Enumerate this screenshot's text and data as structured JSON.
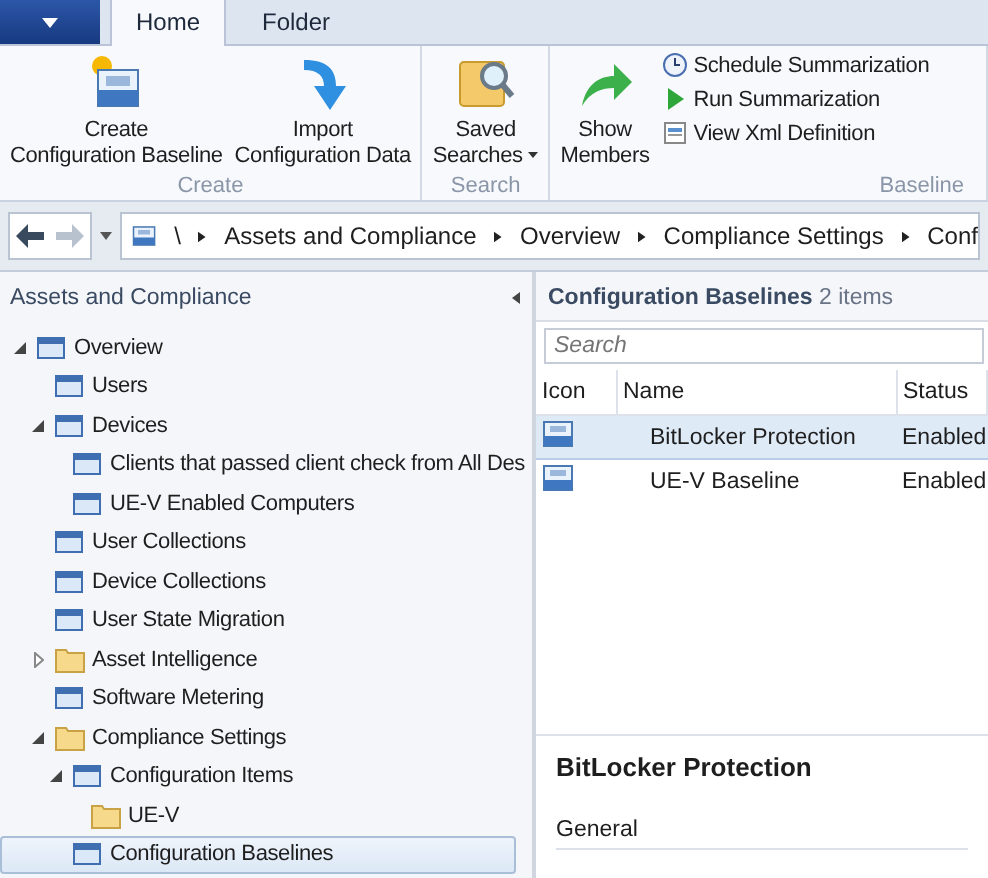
{
  "ribbon_tabs": [
    {
      "label": "Home",
      "selected": true
    },
    {
      "label": "Folder",
      "selected": false
    }
  ],
  "ribbon_groups": [
    {
      "label": "Create",
      "buttons": [
        {
          "kind": "large",
          "lines": [
            "Create",
            "Configuration Baseline"
          ]
        },
        {
          "kind": "large",
          "lines": [
            "Import",
            "Configuration Data"
          ]
        }
      ]
    },
    {
      "label": "Search",
      "buttons": [
        {
          "kind": "large",
          "lines": [
            "Saved",
            "Searches"
          ],
          "dropdown": true
        }
      ]
    },
    {
      "label": "Baseline",
      "buttons": [
        {
          "kind": "large",
          "lines": [
            "Show",
            "Members"
          ]
        },
        {
          "kind": "small",
          "lines": [
            "Schedule Summarization"
          ]
        },
        {
          "kind": "small",
          "lines": [
            "Run Summarization"
          ]
        },
        {
          "kind": "small",
          "lines": [
            "View Xml Definition"
          ]
        }
      ]
    }
  ],
  "address_bar": {
    "root": "\\",
    "crumbs": [
      "Assets and Compliance",
      "Overview",
      "Compliance Settings",
      "Conf"
    ]
  },
  "navigation_pane": {
    "title": "Assets and Compliance",
    "tree": [
      {
        "label": "Overview",
        "kind": "node",
        "expanded": true,
        "selected": false,
        "children": [
          {
            "label": "Users",
            "kind": "node",
            "selected": false
          },
          {
            "label": "Devices",
            "kind": "node",
            "expanded": true,
            "selected": false,
            "children": [
              {
                "label": "Clients that passed client check from All Des",
                "kind": "node",
                "selected": false
              },
              {
                "label": "UE-V Enabled Computers",
                "kind": "node",
                "selected": false
              }
            ]
          },
          {
            "label": "User Collections",
            "kind": "node",
            "selected": false
          },
          {
            "label": "Device Collections",
            "kind": "node",
            "selected": false
          },
          {
            "label": "User State Migration",
            "kind": "node",
            "selected": false
          },
          {
            "label": "Asset Intelligence",
            "kind": "folder",
            "expanded": false,
            "selected": false
          },
          {
            "label": "Software Metering",
            "kind": "node",
            "selected": false
          },
          {
            "label": "Compliance Settings",
            "kind": "folder",
            "expanded": true,
            "selected": false,
            "children": [
              {
                "label": "Configuration Items",
                "kind": "node",
                "expanded": true,
                "selected": false,
                "children": [
                  {
                    "label": "UE-V",
                    "kind": "folder",
                    "selected": false
                  }
                ]
              },
              {
                "label": "Configuration Baselines",
                "kind": "node",
                "selected": true
              }
            ]
          }
        ]
      }
    ]
  },
  "list_pane": {
    "title": "Configuration Baselines",
    "count": "2 items",
    "search": {
      "placeholder": "Search"
    },
    "columns": [
      "Icon",
      "Name",
      "Status"
    ],
    "rows": [
      {
        "name": "BitLocker Protection",
        "status": "Enabled",
        "selected": true
      },
      {
        "name": "UE-V Baseline",
        "status": "Enabled",
        "selected": false
      }
    ]
  },
  "details": {
    "title": "BitLocker Protection",
    "section": "General"
  }
}
